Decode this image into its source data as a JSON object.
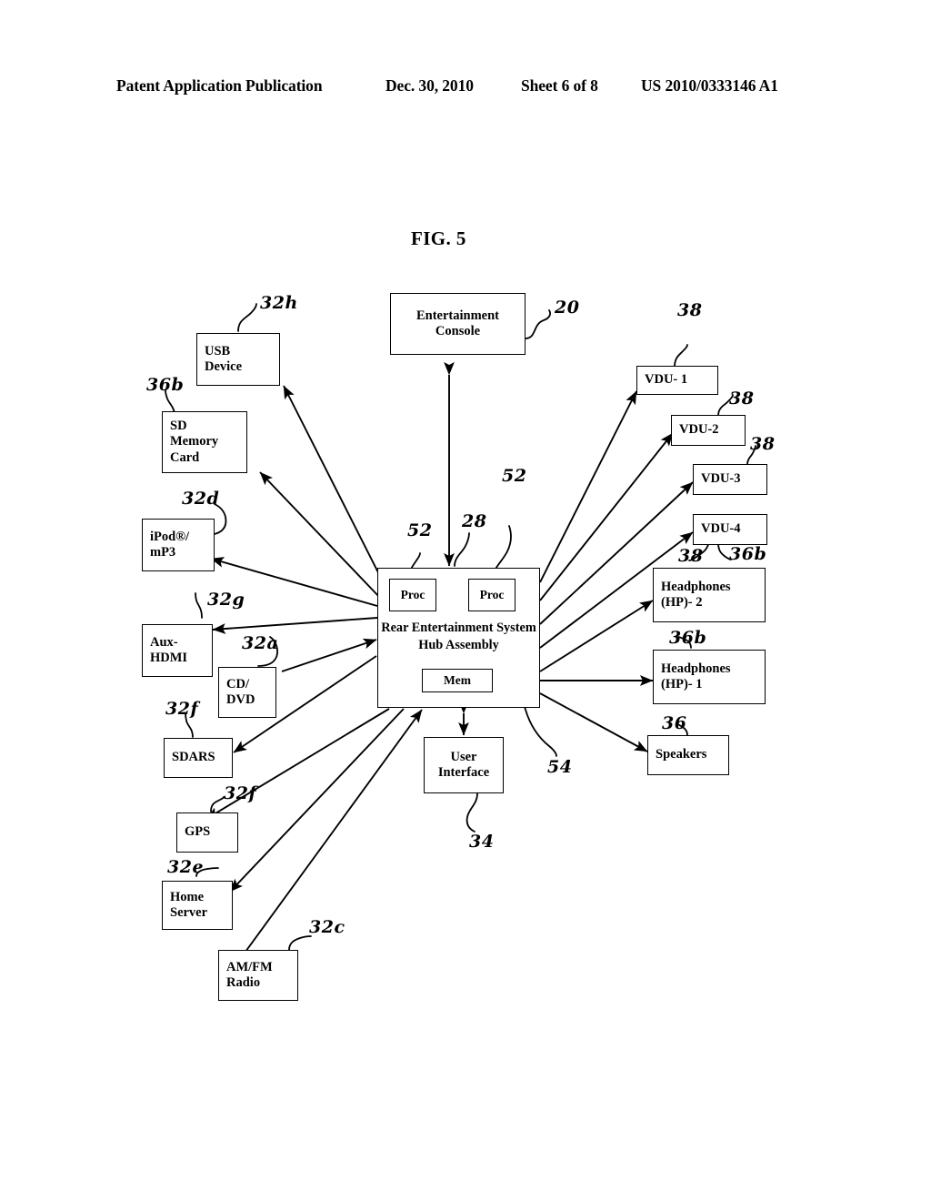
{
  "header": {
    "publication": "Patent Application Publication",
    "date": "Dec. 30, 2010",
    "sheet": "Sheet 6 of 8",
    "number": "US 2010/0333146 A1"
  },
  "figure": {
    "title": "FIG. 5"
  },
  "hub": {
    "label_line1": "Rear Entertainment",
    "label_line2": "System Hub Assembly",
    "proc_left": "Proc",
    "proc_right": "Proc",
    "mem": "Mem",
    "ref_hub": "28",
    "ref_proc_left": "52",
    "ref_proc_right": "52",
    "ref_mem": "54"
  },
  "boxes": {
    "entertainment_console": {
      "line1": "Entertainment",
      "line2": "Console",
      "ref": "20"
    },
    "usb_device": {
      "line1": "USB",
      "line2": "Device",
      "ref": "32h"
    },
    "sd_memory_card": {
      "line1": "SD",
      "line2": "Memory",
      "line3": "Card",
      "ref": "36b"
    },
    "ipod_mp3": {
      "line1": "iPod®/",
      "line2": "mP3",
      "ref": "32d"
    },
    "aux_hdmi": {
      "line1": "Aux-",
      "line2": "HDMI",
      "ref": "32g"
    },
    "cd_dvd": {
      "line1": "CD/",
      "line2": "DVD",
      "ref": "32a"
    },
    "sdars": {
      "line1": "SDARS",
      "ref": "32f"
    },
    "gps": {
      "line1": "GPS",
      "ref": "32f"
    },
    "home_server": {
      "line1": "Home",
      "line2": "Server",
      "ref": "32e"
    },
    "am_fm_radio": {
      "line1": "AM/FM",
      "line2": "Radio",
      "ref": "32c"
    },
    "user_interface": {
      "line1": "User",
      "line2": "Interface",
      "ref": "34"
    },
    "vdu_1": {
      "line1": "VDU- 1",
      "ref": "38"
    },
    "vdu_2": {
      "line1": "VDU-2",
      "ref": "38"
    },
    "vdu_3": {
      "line1": "VDU-3",
      "ref": "38"
    },
    "vdu_4": {
      "line1": "VDU-4",
      "ref": "38"
    },
    "headphones_2": {
      "line1": "Headphones",
      "line2": "(HP)- 2",
      "ref": "36b",
      "ref2": "38"
    },
    "headphones_1": {
      "line1": "Headphones",
      "line2": "(HP)- 1",
      "ref": "36b"
    },
    "speakers": {
      "line1": "Speakers",
      "ref": "36"
    }
  },
  "colors": {
    "ink": "#000000",
    "paper": "#ffffff"
  }
}
